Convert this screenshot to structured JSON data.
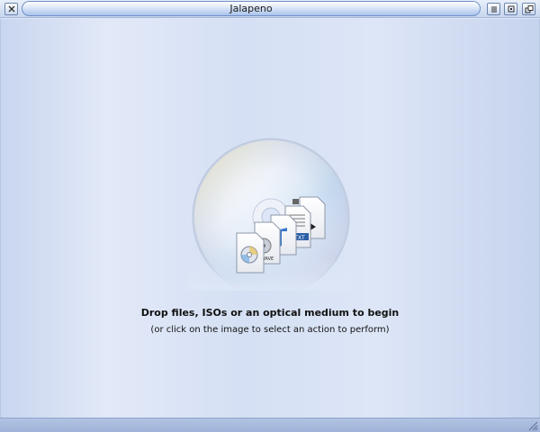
{
  "window": {
    "title": "Jalapeno"
  },
  "titlebar_buttons": {
    "close": "close-icon",
    "minimize": "minimize-icon",
    "maximize": "maximize-icon",
    "restore": "restore-icon"
  },
  "main": {
    "drop_image_icon": "optical-disc-with-files-icon",
    "instruction": "Drop files, ISOs or an optical medium to begin",
    "hint": "(or click on the image to select an action to perform)"
  },
  "file_labels": {
    "wave": "WAVE",
    "txt": "TXT"
  },
  "colors": {
    "accent": "#6f8fc7",
    "background": "#dce6f6",
    "statusbar": "#a8bade"
  }
}
